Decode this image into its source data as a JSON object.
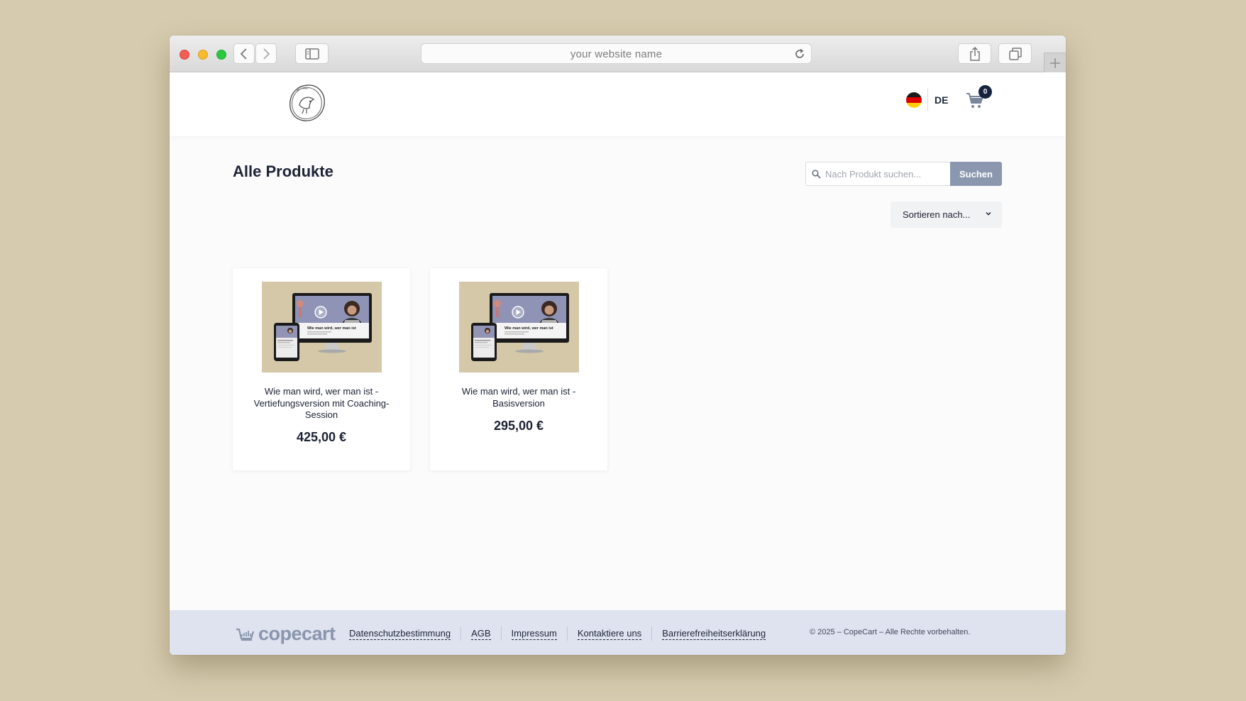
{
  "browser": {
    "address": "your website name"
  },
  "header": {
    "language": "DE",
    "cart_count": "0"
  },
  "main": {
    "title": "Alle Produkte",
    "search_placeholder": "Nach Produkt suchen...",
    "search_button": "Suchen",
    "sort_label": "Sortieren nach..."
  },
  "products": [
    {
      "title": "Wie man wird, wer man ist - Vertiefungsversion mit Coaching-Session",
      "price": "425,00 €"
    },
    {
      "title": "Wie man wird, wer man ist - Basisversion",
      "price": "295,00 €"
    }
  ],
  "thumbnail": {
    "caption": "Wie man wird, wer man ist"
  },
  "footer": {
    "brand": "copecart",
    "links": [
      "Datenschutzbestimmung",
      "AGB",
      "Impressum",
      "Kontaktiere uns",
      "Barrierefreiheitserklärung"
    ],
    "copyright": "© 2025 – CopeCart – Alle Rechte vorbehalten."
  },
  "colors": {
    "backdrop": "#d6cbae",
    "accent_button": "#8a97ae",
    "footer_bg": "#dfe2ef",
    "badge": "#16243d"
  },
  "icons": [
    "back-icon",
    "forward-icon",
    "sidebar-icon",
    "reload-icon",
    "share-icon",
    "tabs-icon",
    "plus-icon",
    "logo-icon",
    "flag-de-icon",
    "cart-icon",
    "search-icon",
    "chevron-down-icon",
    "copecart-logo-icon"
  ]
}
